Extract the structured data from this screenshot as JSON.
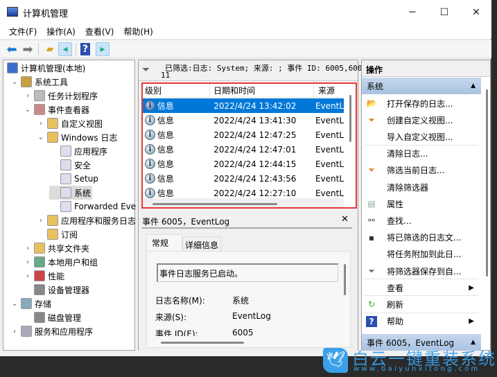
{
  "window": {
    "title": "计算机管理",
    "controls": {
      "minimize": "─",
      "maximize": "☐",
      "close": "✕"
    }
  },
  "menu": [
    "文件(F)",
    "操作(A)",
    "查看(V)",
    "帮助(H)"
  ],
  "toolbar": {
    "back": "back-icon",
    "forward": "forward-icon",
    "up": "up-folder-icon",
    "show_hide_tree": "console-tree-icon",
    "help": "?",
    "show_hide_action": "action-pane-icon"
  },
  "tree": [
    {
      "label": "计算机管理(本地)",
      "level": 0,
      "chev": ""
    },
    {
      "label": "系统工具",
      "level": 1,
      "chev": "v"
    },
    {
      "label": "任务计划程序",
      "level": 2,
      "chev": ">"
    },
    {
      "label": "事件查看器",
      "level": 2,
      "chev": "v"
    },
    {
      "label": "自定义视图",
      "level": 3,
      "chev": ">"
    },
    {
      "label": "Windows 日志",
      "level": 3,
      "chev": "v"
    },
    {
      "label": "应用程序",
      "level": 4,
      "chev": ""
    },
    {
      "label": "安全",
      "level": 4,
      "chev": ""
    },
    {
      "label": "Setup",
      "level": 4,
      "chev": ""
    },
    {
      "label": "系统",
      "level": 4,
      "chev": "",
      "selected": true
    },
    {
      "label": "Forwarded Eve",
      "level": 4,
      "chev": ""
    },
    {
      "label": "应用程序和服务日志",
      "level": 3,
      "chev": ">"
    },
    {
      "label": "订阅",
      "level": 3,
      "chev": ""
    },
    {
      "label": "共享文件夹",
      "level": 2,
      "chev": ">"
    },
    {
      "label": "本地用户和组",
      "level": 2,
      "chev": ">"
    },
    {
      "label": "性能",
      "level": 2,
      "chev": ">"
    },
    {
      "label": "设备管理器",
      "level": 2,
      "chev": ""
    },
    {
      "label": "存储",
      "level": 1,
      "chev": "v"
    },
    {
      "label": "磁盘管理",
      "level": 2,
      "chev": ""
    },
    {
      "label": "服务和应用程序",
      "level": 1,
      "chev": ">"
    }
  ],
  "filter": {
    "line1": "已筛选:日志: System; 来源: ; 事件 ID: 6005,600",
    "line2": "11"
  },
  "events": {
    "columns": [
      "级别",
      "日期和时间",
      "来源"
    ],
    "rows": [
      {
        "level": "信息",
        "datetime": "2022/4/24 13:42:02",
        "source": "EventL"
      },
      {
        "level": "信息",
        "datetime": "2022/4/24 13:41:30",
        "source": "EventL"
      },
      {
        "level": "信息",
        "datetime": "2022/4/24 12:47:25",
        "source": "EventL"
      },
      {
        "level": "信息",
        "datetime": "2022/4/24 12:47:01",
        "source": "EventL"
      },
      {
        "level": "信息",
        "datetime": "2022/4/24 12:44:15",
        "source": "EventL"
      },
      {
        "level": "信息",
        "datetime": "2022/4/24 12:43:56",
        "source": "EventL"
      },
      {
        "level": "信息",
        "datetime": "2022/4/24 12:27:10",
        "source": "EventL"
      }
    ],
    "highlight_color": "#e53935"
  },
  "detail": {
    "title": "事件 6005，EventLog",
    "close": "✕",
    "tabs": [
      "常规",
      "详细信息"
    ],
    "message": "事件日志服务已启动。",
    "fields": [
      {
        "label": "日志名称(M):",
        "value": "系统"
      },
      {
        "label": "来源(S):",
        "value": "EventLog"
      },
      {
        "label": "事件 ID(E):",
        "value": "6005"
      }
    ]
  },
  "actions": {
    "title": "操作",
    "section1": "系统",
    "items": [
      {
        "label": "打开保存的日志...",
        "icon": "open-folder-icon"
      },
      {
        "label": "创建自定义视图...",
        "icon": "filter-icon"
      },
      {
        "label": "导入自定义视图...",
        "icon": ""
      },
      {
        "label": "清除日志...",
        "icon": ""
      },
      {
        "label": "筛选当前日志...",
        "icon": "filter-icon"
      },
      {
        "label": "清除筛选器",
        "icon": ""
      },
      {
        "label": "属性",
        "icon": "properties-icon"
      },
      {
        "label": "查找...",
        "icon": "binoculars-icon"
      },
      {
        "label": "将已筛选的日志文...",
        "icon": "save-icon"
      },
      {
        "label": "将任务附加到此日...",
        "icon": ""
      },
      {
        "label": "将筛选器保存到自...",
        "icon": "filter-save-icon"
      },
      {
        "label": "查看",
        "icon": "",
        "submenu": true
      },
      {
        "label": "刷新",
        "icon": "refresh-icon"
      },
      {
        "label": "帮助",
        "icon": "help-icon",
        "submenu": true
      }
    ],
    "section2": "事件 6005，EventLog"
  },
  "watermark": {
    "brand": "白云一键重装系统",
    "url": "www.baiyunxitong.com",
    "color": "#2b9be8"
  }
}
